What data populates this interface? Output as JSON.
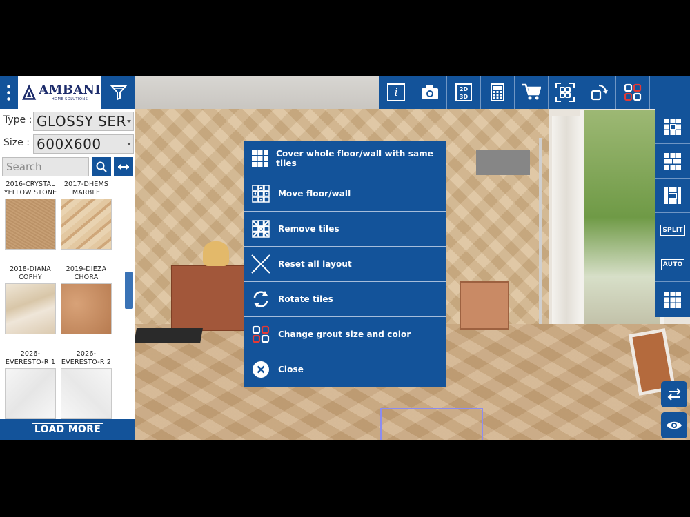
{
  "header": {
    "brand_name": "AMBANI",
    "brand_tagline": "HOME SOLUTIONS",
    "menu_icon": "more-vertical-icon",
    "filter_icon": "filter-icon",
    "toolbar": [
      {
        "id": "info",
        "icon": "info-icon",
        "text": "i"
      },
      {
        "id": "camera",
        "icon": "camera-icon"
      },
      {
        "id": "view-2d-3d",
        "icon": "2d-3d-toggle-icon",
        "text_top": "2D",
        "text_bottom": "3D"
      },
      {
        "id": "calculator",
        "icon": "calculator-icon"
      },
      {
        "id": "cart",
        "icon": "cart-icon"
      },
      {
        "id": "fullscreen",
        "icon": "fullscreen-icon"
      },
      {
        "id": "rotate-view",
        "icon": "rotate-view-icon"
      },
      {
        "id": "layouts",
        "icon": "grid-layout-icon"
      },
      {
        "id": "home",
        "icon": "home-icon"
      }
    ]
  },
  "filters": {
    "type_label": "Type :",
    "type_value": "GLOSSY SER",
    "size_label": "Size :",
    "size_value": "600X600",
    "search_placeholder": "Search"
  },
  "catalog": {
    "items": [
      {
        "name_line1": "2016-CRYSTAL",
        "name_line2": "YELLOW STONE",
        "color": "#c39a70"
      },
      {
        "name_line1": "2017-DHEMS",
        "name_line2": "MARBLE",
        "color": "#d9bd94"
      },
      {
        "name_line1": "2018-DIANA",
        "name_line2": "COPHY",
        "color": "#e6d9c4"
      },
      {
        "name_line1": "2019-DIEZA",
        "name_line2": "CHORA",
        "color": "#c48e62"
      },
      {
        "name_line1": "2026-",
        "name_line2": "EVERESTO-R 1",
        "color": "#f1f1f1"
      },
      {
        "name_line1": "2026-",
        "name_line2": "EVERESTO-R 2",
        "color": "#f3f3f3"
      }
    ],
    "load_more_label": "LOAD MORE"
  },
  "side_toolbar": [
    {
      "id": "pattern-1",
      "icon": "tile-pattern-1-icon"
    },
    {
      "id": "pattern-2",
      "icon": "tile-pattern-2-icon"
    },
    {
      "id": "pattern-3",
      "icon": "tile-pattern-3-icon"
    },
    {
      "id": "split",
      "label": "SPLIT"
    },
    {
      "id": "auto",
      "label": "AUTO"
    },
    {
      "id": "grid",
      "icon": "tile-grid-icon"
    }
  ],
  "popup_menu": {
    "items": [
      {
        "id": "cover",
        "icon": "cover-tiles-icon",
        "label": "Cover whole floor/wall with same tiles"
      },
      {
        "id": "move",
        "icon": "move-floor-icon",
        "label": "Move floor/wall"
      },
      {
        "id": "remove",
        "icon": "remove-tiles-icon",
        "label": "Remove tiles"
      },
      {
        "id": "reset",
        "icon": "reset-layout-icon",
        "label": "Reset all layout"
      },
      {
        "id": "rotate",
        "icon": "rotate-tiles-icon",
        "label": "Rotate tiles"
      },
      {
        "id": "grout",
        "icon": "grout-icon",
        "label": "Change grout size and color"
      },
      {
        "id": "close",
        "icon": "close-icon",
        "label": "Close"
      }
    ]
  },
  "colors": {
    "primary_blue": "#13539a",
    "divider": "#6f96c4",
    "grout_red": "#e53935"
  }
}
